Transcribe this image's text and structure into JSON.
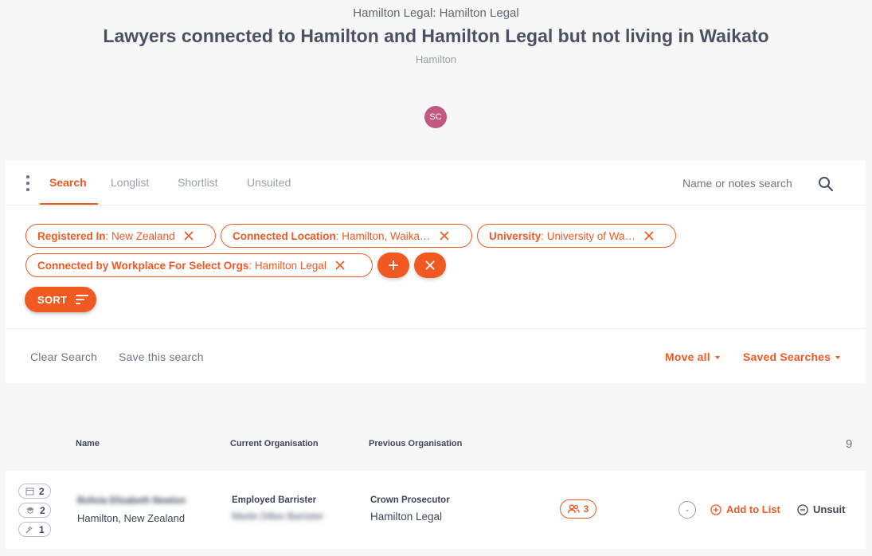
{
  "header": {
    "subtitle": "Hamilton Legal: Hamilton Legal",
    "title": "Lawyers connected to Hamilton and Hamilton Legal but not living in Waikato",
    "location": "Hamilton",
    "avatar_initials": "SC"
  },
  "tabs": [
    {
      "label": "Search",
      "active": true
    },
    {
      "label": "Longlist",
      "active": false
    },
    {
      "label": "Shortlist",
      "active": false
    },
    {
      "label": "Unsuited",
      "active": false
    }
  ],
  "search": {
    "placeholder": "Name or notes search"
  },
  "filters": [
    {
      "key": "Registered In",
      "value": ": New Zealand"
    },
    {
      "key": "Connected Location",
      "value": ": Hamilton, Waika…"
    },
    {
      "key": "University",
      "value": ": University of Wa…"
    },
    {
      "key": "Connected by Workplace For Select Orgs",
      "value": ": Hamilton Legal"
    }
  ],
  "sort_label": "SORT",
  "actions": {
    "clear_search": "Clear Search",
    "save_search": "Save this search",
    "move_all": "Move all",
    "saved_searches": "Saved Searches"
  },
  "table": {
    "columns": {
      "name": "Name",
      "current_org": "Current Organisation",
      "previous_org": "Previous Organisation"
    },
    "count": "9",
    "rows": [
      {
        "stats": {
          "calendar": "2",
          "education": "2",
          "gavel": "1"
        },
        "name": "Bolivia Elizabeth Newton",
        "location": "Hamilton, New Zealand",
        "current_role": "Employed Barrister",
        "current_org": "Martin Dillon Barrister",
        "previous_role": "Crown Prosecutor",
        "previous_org": "Hamilton Legal",
        "connections": "3",
        "status": "-",
        "add_to_list": "Add to List",
        "unsuit": "Unsuit"
      }
    ]
  },
  "colors": {
    "accent": "#f05a22",
    "avatar": "#c2577f",
    "text": "#3d4556"
  }
}
